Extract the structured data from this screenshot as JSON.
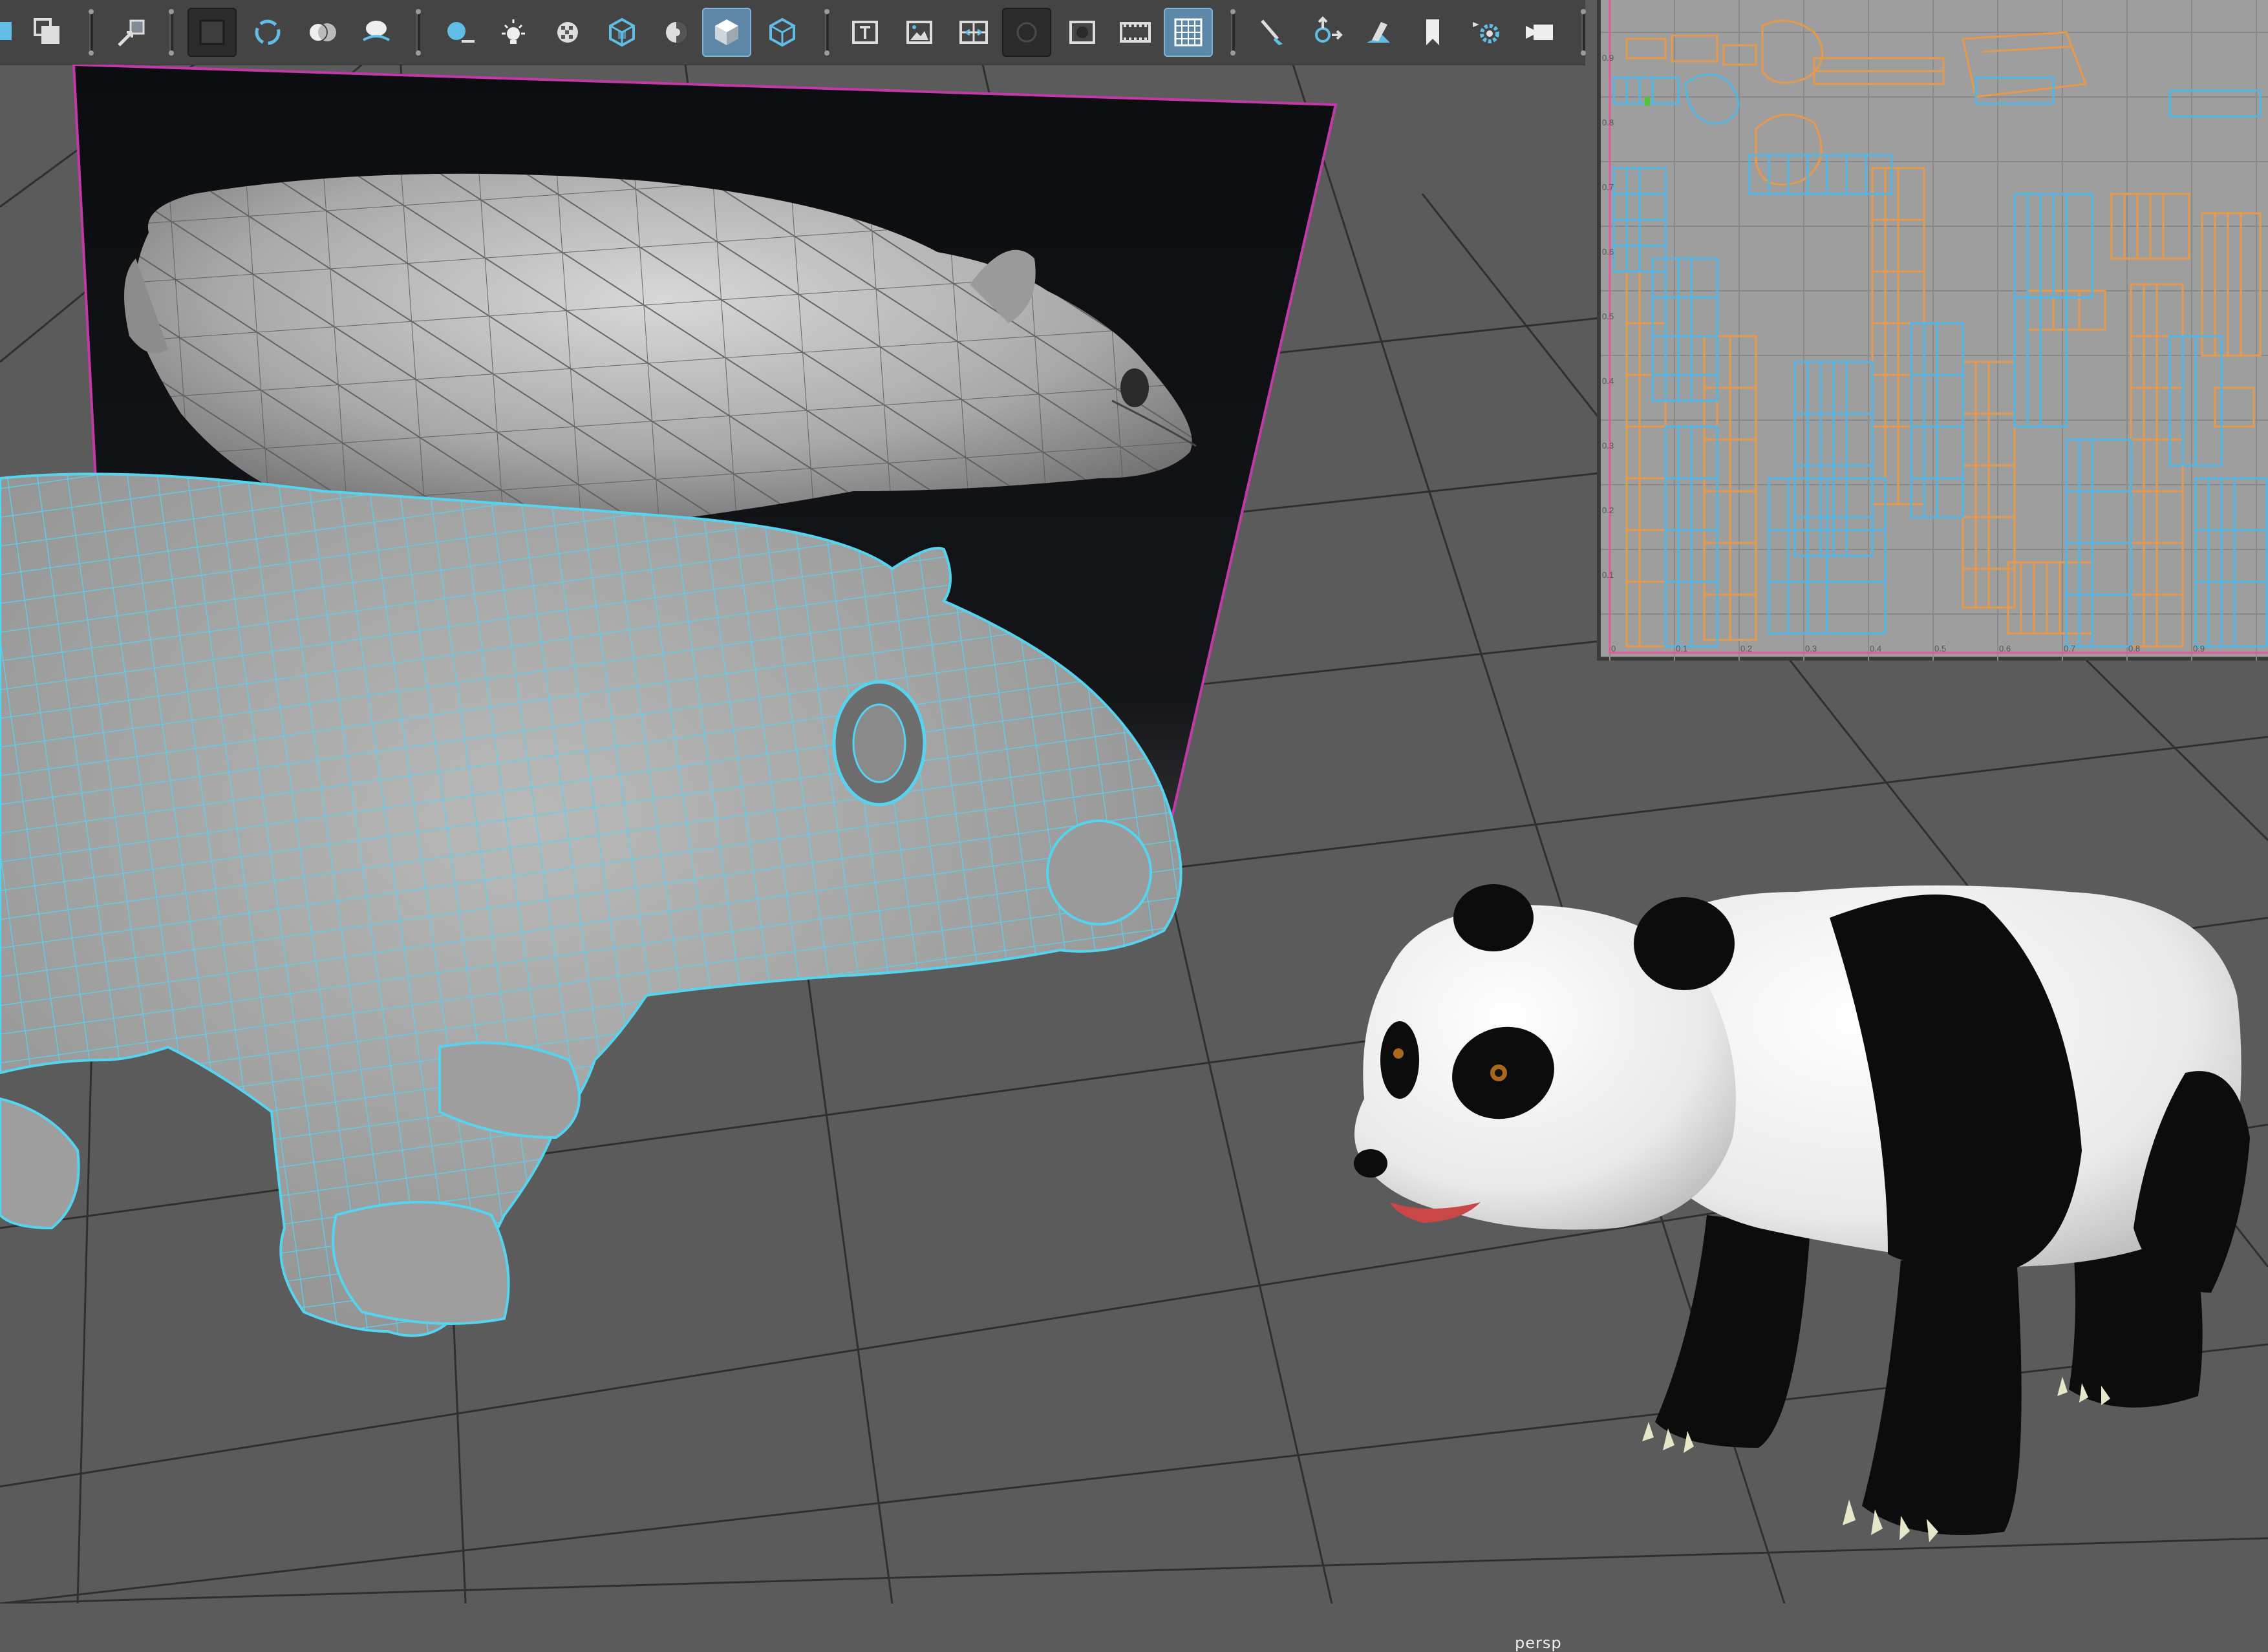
{
  "viewport": {
    "camera_label": "persp"
  },
  "toolbar": {
    "buttons": [
      {
        "name": "select-tool-icon",
        "state": "normal"
      },
      {
        "name": "duplicate-icon",
        "state": "normal"
      },
      {
        "name": "snap-icon",
        "state": "normal"
      },
      {
        "name": "isolate-select-icon",
        "state": "pressed"
      },
      {
        "name": "wireframe-icon",
        "state": "normal"
      },
      {
        "name": "smooth-shade-icon",
        "state": "normal"
      },
      {
        "name": "shade-options-icon",
        "state": "normal"
      },
      {
        "name": "lighting-icon",
        "state": "normal"
      },
      {
        "name": "light-icon",
        "state": "normal"
      },
      {
        "name": "texture-icon",
        "state": "normal"
      },
      {
        "name": "cube-wire-icon",
        "state": "normal"
      },
      {
        "name": "xray-icon",
        "state": "normal"
      },
      {
        "name": "shaded-cube-icon",
        "state": "active"
      },
      {
        "name": "wire-cube-icon",
        "state": "normal"
      },
      {
        "name": "text-icon",
        "state": "normal"
      },
      {
        "name": "image-plane-icon",
        "state": "normal"
      },
      {
        "name": "grid-fit-icon",
        "state": "normal"
      },
      {
        "name": "camera-mask-icon",
        "state": "pressed"
      },
      {
        "name": "resolution-gate-icon",
        "state": "normal"
      },
      {
        "name": "film-gate-icon",
        "state": "normal"
      },
      {
        "name": "grid-icon",
        "state": "active"
      },
      {
        "name": "brush-icon",
        "state": "normal"
      },
      {
        "name": "move-tool-icon",
        "state": "normal"
      },
      {
        "name": "sculpt-icon",
        "state": "normal"
      },
      {
        "name": "bookmark-icon",
        "state": "normal"
      },
      {
        "name": "render-settings-icon",
        "state": "normal"
      },
      {
        "name": "playblast-icon",
        "state": "normal"
      }
    ]
  },
  "uv_editor": {
    "tick_labels_y": [
      "0.9",
      "0.8",
      "0.7",
      "0.6",
      "0.5",
      "0.4",
      "0.3",
      "0.2",
      "0.1"
    ],
    "tick_labels_x": [
      "0",
      "0.1",
      "0.2",
      "0.3",
      "0.4",
      "0.5",
      "0.6",
      "0.7",
      "0.8",
      "0.9"
    ]
  },
  "colors": {
    "viewport_bg": "#5b5b5b",
    "wireframe": "#55d4f0",
    "uv_orange": "#e79a4c",
    "uv_blue": "#4fb6e6",
    "image_plane_border": "#c23aa8",
    "toolbar_bg": "#444444",
    "active_button": "#5d87a6"
  }
}
